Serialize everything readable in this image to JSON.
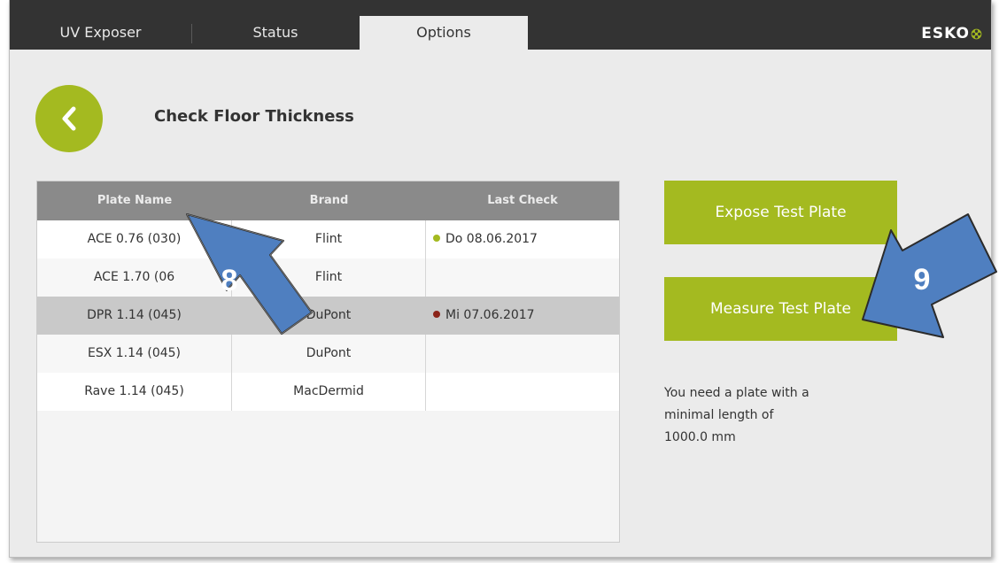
{
  "nav": {
    "tabs": [
      {
        "label": "UV Exposer"
      },
      {
        "label": "Status"
      },
      {
        "label": "Options",
        "active": true
      }
    ],
    "brand": "ESKO"
  },
  "page": {
    "title": "Check Floor Thickness"
  },
  "table": {
    "headers": [
      "Plate Name",
      "Brand",
      "Last Check"
    ],
    "rows": [
      {
        "plate": "ACE 0.76 (030)",
        "brand": "Flint",
        "last_check": "Do 08.06.2017",
        "status_color": "#a4ba20"
      },
      {
        "plate": "ACE 1.70 (06",
        "brand": "Flint",
        "last_check": ""
      },
      {
        "plate": "DPR 1.14 (045)",
        "brand": "DuPont",
        "last_check": "Mi 07.06.2017",
        "status_color": "#8b2318",
        "selected": true
      },
      {
        "plate": "ESX 1.14 (045)",
        "brand": "DuPont",
        "last_check": ""
      },
      {
        "plate": "Rave 1.14 (045)",
        "brand": "MacDermid",
        "last_check": ""
      }
    ]
  },
  "actions": {
    "expose_label": "Expose Test Plate",
    "measure_label": "Measure Test Plate"
  },
  "info": {
    "line1": "You need a plate with a",
    "line2": "minimal length of",
    "line3": "1000.0 mm"
  },
  "annotations": {
    "arrow_8_label": "8",
    "arrow_9_label": "9"
  },
  "colors": {
    "accent": "#a4ba20",
    "header_bg": "#333333",
    "arrow_fill": "#4f7fc0"
  },
  "icons": {
    "back": "chevron-left-icon",
    "logo_mark": "esko-flower-icon",
    "arrows": "annotation-arrow-icon"
  }
}
